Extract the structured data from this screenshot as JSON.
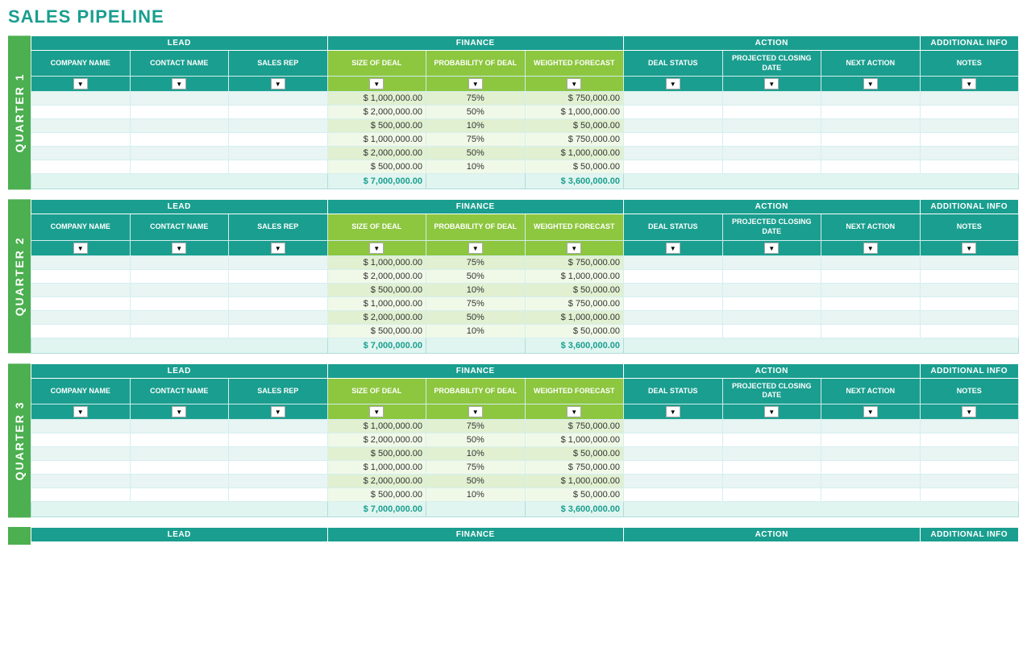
{
  "page": {
    "title": "SALES PIPELINE"
  },
  "sections": {
    "lead": "LEAD",
    "finance": "FINANCE",
    "action": "ACTION",
    "additional_info": "ADDITIONAL INFO"
  },
  "col_headers": {
    "company_name": "COMPANY NAME",
    "contact_name": "CONTACT NAME",
    "sales_rep": "SALES REP",
    "size_of_deal": "SIZE OF DEAL",
    "probability_of_deal": "PROBABILITY OF DEAL",
    "weighted_forecast": "WEIGHTED FORECAST",
    "deal_status": "DEAL STATUS",
    "projected_closing_date": "PROJECTED CLOSING DATE",
    "next_action": "NEXT ACTION",
    "notes": "NOTES"
  },
  "quarters": [
    {
      "label": "QUARTER 1"
    },
    {
      "label": "QUARTER 2"
    },
    {
      "label": "QUARTER 3"
    }
  ],
  "data_rows": [
    {
      "size": "$ 1,000,000.00",
      "prob": "75%",
      "weighted": "$ 750,000.00"
    },
    {
      "size": "$ 2,000,000.00",
      "prob": "50%",
      "weighted": "$ 1,000,000.00"
    },
    {
      "size": "$ 500,000.00",
      "prob": "10%",
      "weighted": "$ 50,000.00"
    },
    {
      "size": "$ 1,000,000.00",
      "prob": "75%",
      "weighted": "$ 750,000.00"
    },
    {
      "size": "$ 2,000,000.00",
      "prob": "50%",
      "weighted": "$ 1,000,000.00"
    },
    {
      "size": "$ 500,000.00",
      "prob": "10%",
      "weighted": "$ 50,000.00"
    }
  ],
  "totals": {
    "size": "$ 7,000,000.00",
    "weighted": "$ 3,600,000.00"
  },
  "filter_symbol": "▼"
}
